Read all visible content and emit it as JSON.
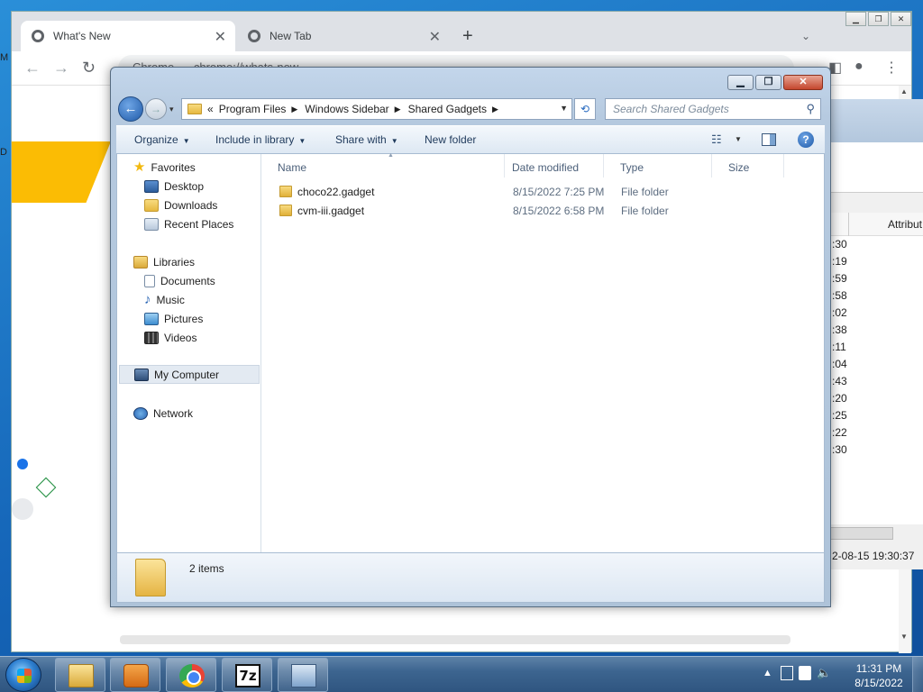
{
  "chrome": {
    "tabs": [
      {
        "label": "What's New"
      },
      {
        "label": "New Tab"
      }
    ],
    "url_scheme": "Chrome",
    "url": "chrome://whats-new"
  },
  "left_edge": {
    "m1": "M",
    "m2": "D"
  },
  "zip": {
    "column_header": "Attribut",
    "times": [
      ":30",
      ":19",
      ":59",
      ":58",
      ":02",
      ":38",
      ":11",
      ":04",
      ":43",
      ":20",
      ":25",
      ":22",
      ":30"
    ],
    "status": "2-08-15 19:30:37"
  },
  "explorer": {
    "breadcrumb": [
      "Program Files",
      "Windows Sidebar",
      "Shared Gadgets"
    ],
    "overflow": "«",
    "search_placeholder": "Search Shared Gadgets",
    "commands": {
      "organize": "Organize",
      "include": "Include in library",
      "share": "Share with",
      "new_folder": "New folder"
    },
    "nav": {
      "favorites": "Favorites",
      "desktop": "Desktop",
      "downloads": "Downloads",
      "recent": "Recent Places",
      "libraries": "Libraries",
      "documents": "Documents",
      "music": "Music",
      "pictures": "Pictures",
      "videos": "Videos",
      "computer": "My Computer",
      "network": "Network"
    },
    "columns": {
      "name": "Name",
      "date": "Date modified",
      "type": "Type",
      "size": "Size"
    },
    "files": [
      {
        "name": "choco22.gadget",
        "date": "8/15/2022 7:25 PM",
        "type": "File folder"
      },
      {
        "name": "cvm-iii.gadget",
        "date": "8/15/2022 6:58 PM",
        "type": "File folder"
      }
    ],
    "item_count": "2 items"
  },
  "taskbar": {
    "time": "11:31 PM",
    "date": "8/15/2022"
  }
}
